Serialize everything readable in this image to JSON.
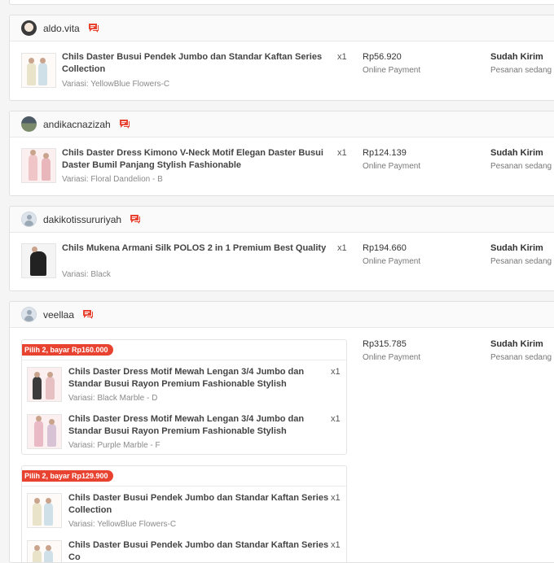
{
  "colors": {
    "accent": "#e84330",
    "card_bg": "#ffffff",
    "page_bg": "#f5f5f5"
  },
  "orders": [
    {
      "username": "aldo.vita",
      "product": "Chils Daster Busui Pendek Jumbo dan Standar Kaftan Series Collection",
      "variant": "Variasi: YellowBlue Flowers-C",
      "qty": "x1",
      "price": "Rp56.920",
      "payment": "Online Payment",
      "status": "Sudah Kirim",
      "status_note": "Pesanan sedang di"
    },
    {
      "username": "andikacnazizah",
      "product": "Chils Daster Dress Kimono V-Neck Motif Elegan Daster Busui Daster Bumil Panjang Stylish Fashionable",
      "variant": "Variasi: Floral Dandelion - B",
      "qty": "x1",
      "price": "Rp124.139",
      "payment": "Online Payment",
      "status": "Sudah Kirim",
      "status_note": "Pesanan sedang di"
    },
    {
      "username": "dakikotissururiyah",
      "product": "Chils Mukena Armani Silk POLOS 2 in 1 Premium Best Quality",
      "variant": "Variasi: Black",
      "qty": "x1",
      "price": "Rp194.660",
      "payment": "Online Payment",
      "status": "Sudah Kirim",
      "status_note": "Pesanan sedang di"
    },
    {
      "username": "veellaa",
      "price": "Rp315.785",
      "payment": "Online Payment",
      "status": "Sudah Kirim",
      "status_note": "Pesanan sedang di",
      "bundles": [
        {
          "tag": "Pilih 2, bayar Rp160.000",
          "items": [
            {
              "product": "Chils Daster Dress Motif Mewah Lengan 3/4 Jumbo dan Standar Busui Rayon Premium Fashionable Stylish",
              "variant": "Variasi: Black Marble - D",
              "qty": "x1"
            },
            {
              "product": "Chils Daster Dress Motif Mewah Lengan 3/4 Jumbo dan Standar Busui Rayon Premium Fashionable Stylish",
              "variant": "Variasi: Purple Marble - F",
              "qty": "x1"
            }
          ]
        },
        {
          "tag": "Pilih 2, bayar Rp129.900",
          "items": [
            {
              "product": "Chils Daster Busui Pendek Jumbo dan Standar Kaftan Series Collection",
              "variant": "Variasi: YellowBlue Flowers-C",
              "qty": "x1"
            },
            {
              "product": "Chils Daster Busui Pendek Jumbo dan Standar Kaftan Series Co",
              "variant": "",
              "qty": "x1"
            }
          ]
        }
      ]
    }
  ]
}
